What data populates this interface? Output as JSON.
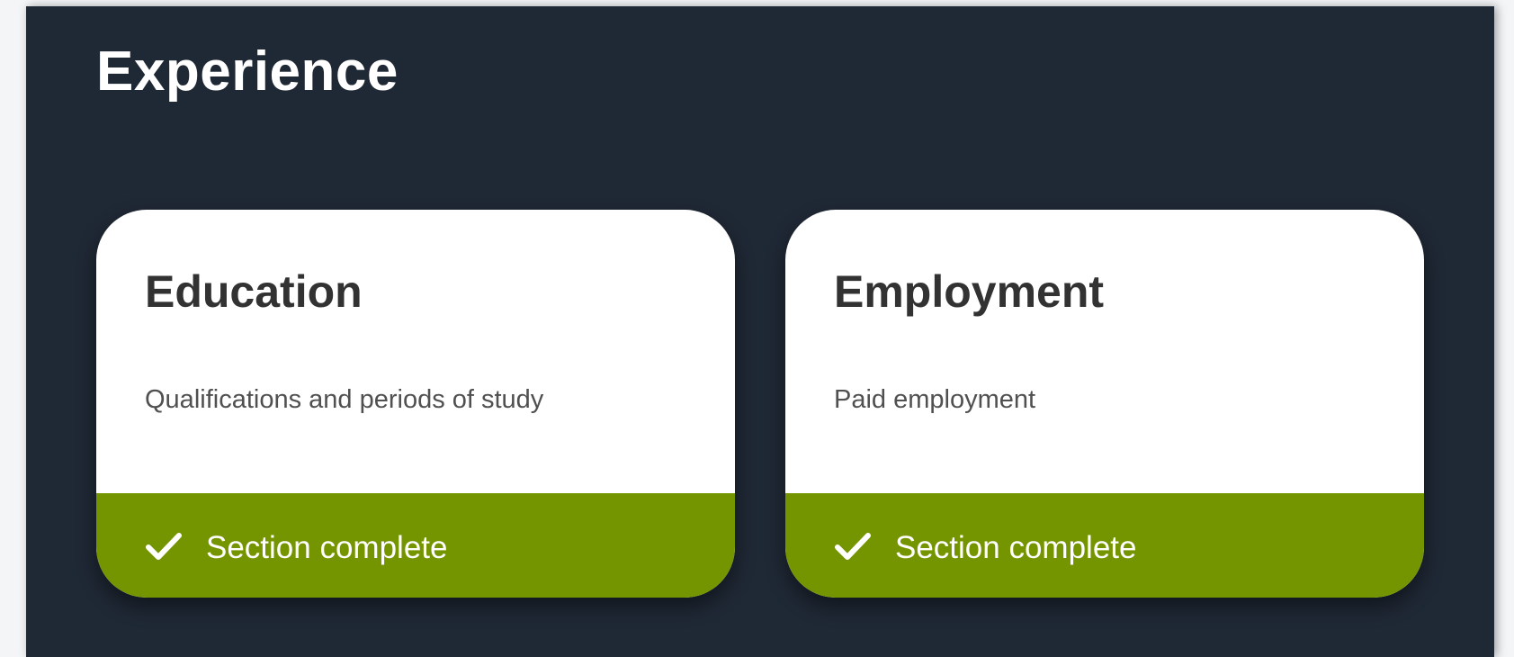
{
  "section": {
    "title": "Experience"
  },
  "cards": [
    {
      "title": "Education",
      "description": "Qualifications and periods of study",
      "status": "Section complete",
      "status_icon": "check-icon"
    },
    {
      "title": "Employment",
      "description": "Paid employment",
      "status": "Section complete",
      "status_icon": "check-icon"
    }
  ],
  "colors": {
    "panel_background": "#1f2835",
    "card_background": "#ffffff",
    "complete_status": "#759500",
    "heading_text": "#ffffff",
    "card_title_text": "#323232"
  }
}
